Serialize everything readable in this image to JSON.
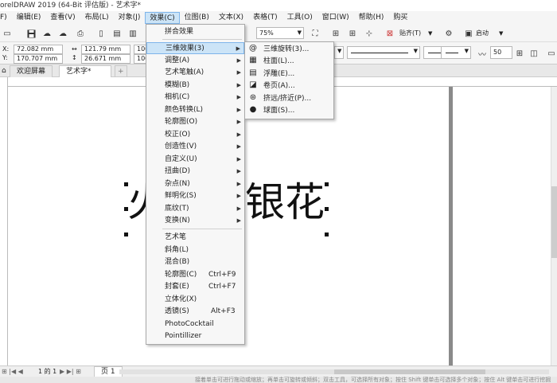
{
  "window": {
    "title": "orelDRAW 2019 (64-Bit 评估版) - 艺术字*"
  },
  "menubar": {
    "items": [
      {
        "label": "F)"
      },
      {
        "label": "编辑(E)"
      },
      {
        "label": "查看(V)"
      },
      {
        "label": "布局(L)"
      },
      {
        "label": "对象(J)"
      },
      {
        "label": "效果(C)"
      },
      {
        "label": "位图(B)"
      },
      {
        "label": "文本(X)"
      },
      {
        "label": "表格(T)"
      },
      {
        "label": "工具(O)"
      },
      {
        "label": "窗口(W)"
      },
      {
        "label": "帮助(H)"
      },
      {
        "label": "购买"
      }
    ]
  },
  "toolbar": {
    "zoom_value": "75%",
    "paste_label": "贴齐(T)",
    "launch_label": "启动"
  },
  "propbar": {
    "x_label": "X:",
    "y_label": "Y:",
    "x_value": "72.082 mm",
    "y_value": "170.707 mm",
    "w_value": "121.79 mm",
    "h_value": "26.671 mm",
    "scale_w": "100",
    "scale_h": "100",
    "outline_width": "50"
  },
  "tabs": {
    "welcome": "欢迎屏幕",
    "doc": "艺术字*",
    "add": "+"
  },
  "canvas": {
    "text_left": "火",
    "text_right": "银花"
  },
  "pagenav": {
    "page_info": "1 的 1",
    "page_tab": "页 1"
  },
  "status": {
    "text": "接着单击可进行拖动或缩放；再单击可旋转或倾斜；双击工具，可选择所有对象；按住 Shift 键单击可选择多个对象；按住 Alt 键单击可进行挖掘"
  },
  "effects_menu": {
    "items": [
      {
        "label": "拼合效果",
        "arrow": false
      },
      {
        "label": "三维效果(3)",
        "arrow": true
      },
      {
        "label": "调整(A)",
        "arrow": true
      },
      {
        "label": "艺术笔触(A)",
        "arrow": true
      },
      {
        "label": "模糊(B)",
        "arrow": true
      },
      {
        "label": "相机(C)",
        "arrow": true
      },
      {
        "label": "颜色转换(L)",
        "arrow": true
      },
      {
        "label": "轮廓图(O)",
        "arrow": true
      },
      {
        "label": "校正(O)",
        "arrow": true
      },
      {
        "label": "创造性(V)",
        "arrow": true
      },
      {
        "label": "自定义(U)",
        "arrow": true
      },
      {
        "label": "扭曲(D)",
        "arrow": true
      },
      {
        "label": "杂点(N)",
        "arrow": true
      },
      {
        "label": "鲜明化(S)",
        "arrow": true
      },
      {
        "label": "底纹(T)",
        "arrow": true
      },
      {
        "label": "变换(N)",
        "arrow": true
      },
      {
        "label": "艺术笔",
        "arrow": false
      },
      {
        "label": "斜角(L)",
        "arrow": false
      },
      {
        "label": "混合(B)",
        "arrow": false
      },
      {
        "label": "轮廓图(C)",
        "arrow": false,
        "shortcut": "Ctrl+F9"
      },
      {
        "label": "封套(E)",
        "arrow": false,
        "shortcut": "Ctrl+F7"
      },
      {
        "label": "立体化(X)",
        "arrow": false
      },
      {
        "label": "透镜(S)",
        "arrow": false,
        "shortcut": "Alt+F3"
      },
      {
        "label": "PhotoCocktail",
        "arrow": false
      },
      {
        "label": "Pointillizer",
        "arrow": false
      }
    ]
  },
  "submenu_3d": {
    "items": [
      {
        "label": "三维旋转(3)...",
        "icon": "rotate-3d-icon"
      },
      {
        "label": "柱面(L)...",
        "icon": "cylinder-icon"
      },
      {
        "label": "浮雕(E)...",
        "icon": "emboss-icon"
      },
      {
        "label": "卷页(A)...",
        "icon": "page-curl-icon"
      },
      {
        "label": "挤远/挤近(P)...",
        "icon": "pinch-punch-icon"
      },
      {
        "label": "球面(S)...",
        "icon": "sphere-icon"
      }
    ]
  }
}
